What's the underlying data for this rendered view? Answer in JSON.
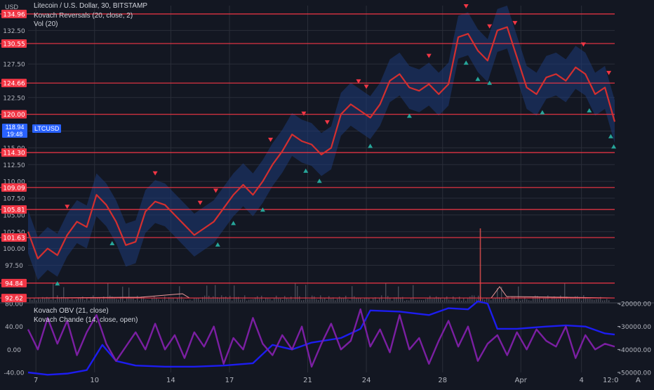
{
  "header": {
    "title": "Litecoin / U.S. Dollar, 30, BITSTAMP",
    "indicators": [
      "Kovach Reversals (20, close, 2)",
      "Vol (20)"
    ],
    "currency": "USD"
  },
  "lower_pane": {
    "indicators": [
      "Kovach OBV (21, close)",
      "Kovach Chande (14, close, open)"
    ]
  },
  "symbol_badge": "LTCUSD",
  "price_badge": {
    "price": "118.94",
    "countdown": "19:48"
  },
  "time_axis_end": "12:0",
  "corner_label": "A",
  "colors": {
    "background": "#131722",
    "grid": "#2a2e39",
    "hline": "#f23645",
    "price_line": "#d32f2f",
    "band": "#1e3a78",
    "up_marker": "#26a69a",
    "down_marker": "#f23645",
    "obv": "#1d1df0",
    "chande": "#7b1fa2",
    "badge_blue": "#2962ff"
  },
  "chart_data": [
    {
      "type": "line",
      "title": "Litecoin / U.S. Dollar, 30, BITSTAMP",
      "ylim": [
        92.0,
        136.2
      ],
      "y_ticks": [
        "97.50",
        "100.00",
        "102.50",
        "105.00",
        "107.50",
        "110.00",
        "112.50",
        "115.00",
        "117.50",
        "122.50",
        "127.50",
        "132.50"
      ],
      "x_ticks": [
        "7",
        "10",
        "14",
        "17",
        "21",
        "24",
        "28",
        "Apr",
        "4"
      ],
      "x_tick_positions": [
        0.4,
        3.4,
        7.3,
        10.3,
        14.3,
        17.3,
        21.2,
        25.2,
        28.3
      ],
      "xlim": [
        0,
        30
      ],
      "horizontal_levels": [
        134.96,
        130.55,
        124.66,
        120.0,
        114.3,
        109.09,
        105.81,
        101.63,
        94.84,
        92.62
      ],
      "horizontal_level_labels": [
        "134.96",
        "130.55",
        "124.66",
        "120.00",
        "114.30",
        "109.09",
        "105.81",
        "101.63",
        "94.84",
        "92.62"
      ],
      "series": [
        {
          "x": [
            0.0,
            0.5,
            1.0,
            1.5,
            2.0,
            2.5,
            3.0,
            3.5,
            4.0,
            4.5,
            5.0,
            5.5,
            6.0,
            6.5,
            7.0,
            7.5,
            8.0,
            8.5,
            9.0,
            9.5,
            10.0,
            10.5,
            11.0,
            11.5,
            12.0,
            12.5,
            13.0,
            13.5,
            14.0,
            14.5,
            15.0,
            15.5,
            16.0,
            16.5,
            17.0,
            17.5,
            18.0,
            18.5,
            19.0,
            19.5,
            20.0,
            20.5,
            21.0,
            21.5,
            22.0,
            22.5,
            23.0,
            23.5,
            24.0,
            24.5,
            25.0,
            25.5,
            26.0,
            26.5,
            27.0,
            27.5,
            28.0,
            28.5,
            29.0,
            29.5,
            30.0
          ],
          "values": [
            102.5,
            98.5,
            100.0,
            99.0,
            102.0,
            104.0,
            103.2,
            108.0,
            106.5,
            104.0,
            100.5,
            101.0,
            105.5,
            107.0,
            106.5,
            105.0,
            103.5,
            102.0,
            103.0,
            104.0,
            106.0,
            108.0,
            109.5,
            108.0,
            110.0,
            112.5,
            114.5,
            117.0,
            116.0,
            115.5,
            114.0,
            115.0,
            120.0,
            121.5,
            120.5,
            119.5,
            121.5,
            125.0,
            126.0,
            124.0,
            123.5,
            124.5,
            123.0,
            124.5,
            131.5,
            132.0,
            129.5,
            128.0,
            132.5,
            133.0,
            128.5,
            124.0,
            123.0,
            125.5,
            126.0,
            125.0,
            127.0,
            126.0,
            123.0,
            124.0,
            118.9
          ]
        }
      ],
      "markers_up_x": [
        1.5,
        4.3,
        9.7,
        10.5,
        12.0,
        14.2,
        14.9,
        17.5,
        19.5,
        22.4,
        23.0,
        23.6,
        26.3,
        28.7,
        29.8,
        31.0
      ],
      "markers_down_x": [
        2.0,
        6.5,
        8.8,
        9.6,
        12.4,
        14.1,
        15.3,
        16.9,
        17.3,
        20.5,
        22.4,
        23.6,
        24.9,
        28.4,
        29.7
      ],
      "volume_spike_x": [
        23.1
      ]
    },
    {
      "type": "line",
      "title": "",
      "y_left_ticks": [
        "80.00",
        "40.00",
        "0.00",
        "-40.00"
      ],
      "y_left_range": [
        -40,
        80
      ],
      "y_right_ticks": [
        "-20000.00",
        "-30000.00",
        "-40000.00",
        "-50000.00"
      ],
      "y_right_range": [
        -50000,
        -20000
      ],
      "series": [
        {
          "name": "Kovach OBV (21, close)",
          "x": [
            0.0,
            1.0,
            2.0,
            3.0,
            3.8,
            4.5,
            5.5,
            7.0,
            8.5,
            10.0,
            11.5,
            12.5,
            13.5,
            14.5,
            16.0,
            17.0,
            17.5,
            19.0,
            20.5,
            21.5,
            22.5,
            23.0,
            23.5,
            24.0,
            25.0,
            26.5,
            27.5,
            28.5,
            29.5,
            30.0
          ],
          "values": [
            -50000,
            -51000,
            -50500,
            -49000,
            -38000,
            -45000,
            -47000,
            -47500,
            -47500,
            -47000,
            -46000,
            -38000,
            -40000,
            -37000,
            -35000,
            -31000,
            -23000,
            -23500,
            -25000,
            -22000,
            -22500,
            -19000,
            -20000,
            -31000,
            -31000,
            -30000,
            -29500,
            -30000,
            -33000,
            -33500
          ]
        },
        {
          "name": "Kovach Chande (14, close, open)",
          "x": [
            0.0,
            0.5,
            1.0,
            1.5,
            2.0,
            2.5,
            3.0,
            3.5,
            4.0,
            4.5,
            5.0,
            5.5,
            6.0,
            6.5,
            7.0,
            7.5,
            8.0,
            8.5,
            9.0,
            9.5,
            10.0,
            10.5,
            11.0,
            11.5,
            12.0,
            12.5,
            13.0,
            13.5,
            14.0,
            14.5,
            15.0,
            15.5,
            16.0,
            16.5,
            17.0,
            17.5,
            18.0,
            18.5,
            19.0,
            19.5,
            20.0,
            20.5,
            21.0,
            21.5,
            22.0,
            22.5,
            23.0,
            23.5,
            24.0,
            24.5,
            25.0,
            25.5,
            26.0,
            26.5,
            27.0,
            27.5,
            28.0,
            28.5,
            29.0,
            29.5,
            30.0
          ],
          "values": [
            35,
            0,
            55,
            10,
            50,
            -10,
            30,
            60,
            10,
            -20,
            5,
            30,
            0,
            45,
            0,
            25,
            -15,
            30,
            5,
            40,
            -25,
            20,
            0,
            55,
            10,
            -10,
            25,
            0,
            40,
            -30,
            10,
            45,
            0,
            15,
            70,
            5,
            35,
            -5,
            60,
            0,
            20,
            -25,
            15,
            50,
            5,
            40,
            -20,
            10,
            25,
            -10,
            30,
            0,
            35,
            15,
            5,
            40,
            -15,
            25,
            0,
            10,
            5
          ]
        }
      ]
    }
  ]
}
